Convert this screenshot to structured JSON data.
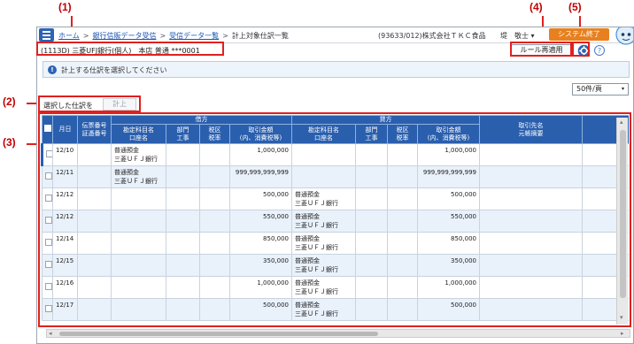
{
  "callouts": [
    "(1)",
    "(2)",
    "(3)",
    "(4)",
    "(5)"
  ],
  "breadcrumb": {
    "items": [
      "ホーム",
      "銀行信販データ受信",
      "受信データ一覧"
    ],
    "separator": ">",
    "current": "計上対象仕訳一覧"
  },
  "header": {
    "company": "(93633/012)株式会社ＴＫＣ食品",
    "user": "堤　敬士",
    "user_menu_caret": "▾",
    "system_end_label": "システム終了"
  },
  "account_line": "(1113D) 三菱UFJ銀行(個人)　本店 普通 ***0001",
  "toolbar": {
    "rule_reapply_label": "ルール再適用",
    "help_label": "?"
  },
  "info": {
    "icon": "!",
    "message": "計上する仕訳を選択してください"
  },
  "pager": {
    "selected": "50件/頁",
    "caret": "▾"
  },
  "selection": {
    "label": "選択した仕訳を",
    "post_label": "計上"
  },
  "table": {
    "headers": {
      "date": "月日",
      "voucher": [
        "伝票番号",
        "証憑番号"
      ],
      "debit_group": "借方",
      "credit_group": "貸方",
      "account": [
        "勘定科目名",
        "口座名"
      ],
      "dept": [
        "部門",
        "工事"
      ],
      "tax": [
        "税区",
        "税率"
      ],
      "amount": [
        "取引金額",
        "(内、消費税等)"
      ],
      "partner": [
        "取引先名",
        "元帳摘要"
      ]
    },
    "rows": [
      {
        "date": "12/10",
        "debit_account": [
          "普通預金",
          "三菱ＵＦＪ銀行"
        ],
        "debit_amount": "1,000,000",
        "credit_account": [
          "",
          ""
        ],
        "credit_amount": "1,000,000"
      },
      {
        "date": "12/11",
        "debit_account": [
          "普通預金",
          "三菱ＵＦＪ銀行"
        ],
        "debit_amount": "999,999,999,999",
        "credit_account": [
          "",
          ""
        ],
        "credit_amount": "999,999,999,999"
      },
      {
        "date": "12/12",
        "debit_account": [
          "",
          ""
        ],
        "debit_amount": "500,000",
        "credit_account": [
          "普通預金",
          "三菱ＵＦＪ銀行"
        ],
        "credit_amount": "500,000"
      },
      {
        "date": "12/12",
        "debit_account": [
          "",
          ""
        ],
        "debit_amount": "550,000",
        "credit_account": [
          "普通預金",
          "三菱ＵＦＪ銀行"
        ],
        "credit_amount": "550,000"
      },
      {
        "date": "12/14",
        "debit_account": [
          "",
          ""
        ],
        "debit_amount": "850,000",
        "credit_account": [
          "普通預金",
          "三菱ＵＦＪ銀行"
        ],
        "credit_amount": "850,000"
      },
      {
        "date": "12/15",
        "debit_account": [
          "",
          ""
        ],
        "debit_amount": "350,000",
        "credit_account": [
          "普通預金",
          "三菱ＵＦＪ銀行"
        ],
        "credit_amount": "350,000"
      },
      {
        "date": "12/16",
        "debit_account": [
          "",
          ""
        ],
        "debit_amount": "1,000,000",
        "credit_account": [
          "普通預金",
          "三菱ＵＦＪ銀行"
        ],
        "credit_amount": "1,000,000"
      },
      {
        "date": "12/17",
        "debit_account": [
          "",
          ""
        ],
        "debit_amount": "500,000",
        "credit_account": [
          "普通預金",
          "三菱ＵＦＪ銀行"
        ],
        "credit_amount": "500,000"
      }
    ]
  },
  "scroll": {
    "left_arrow": "◂",
    "right_arrow": "▸",
    "up_arrow": "▴",
    "down_arrow": "▾"
  },
  "colors": {
    "header_blue": "#2a5fae",
    "accent_orange": "#e8801f",
    "callout_red": "#e02020",
    "row_alt": "#e9f1fa"
  }
}
